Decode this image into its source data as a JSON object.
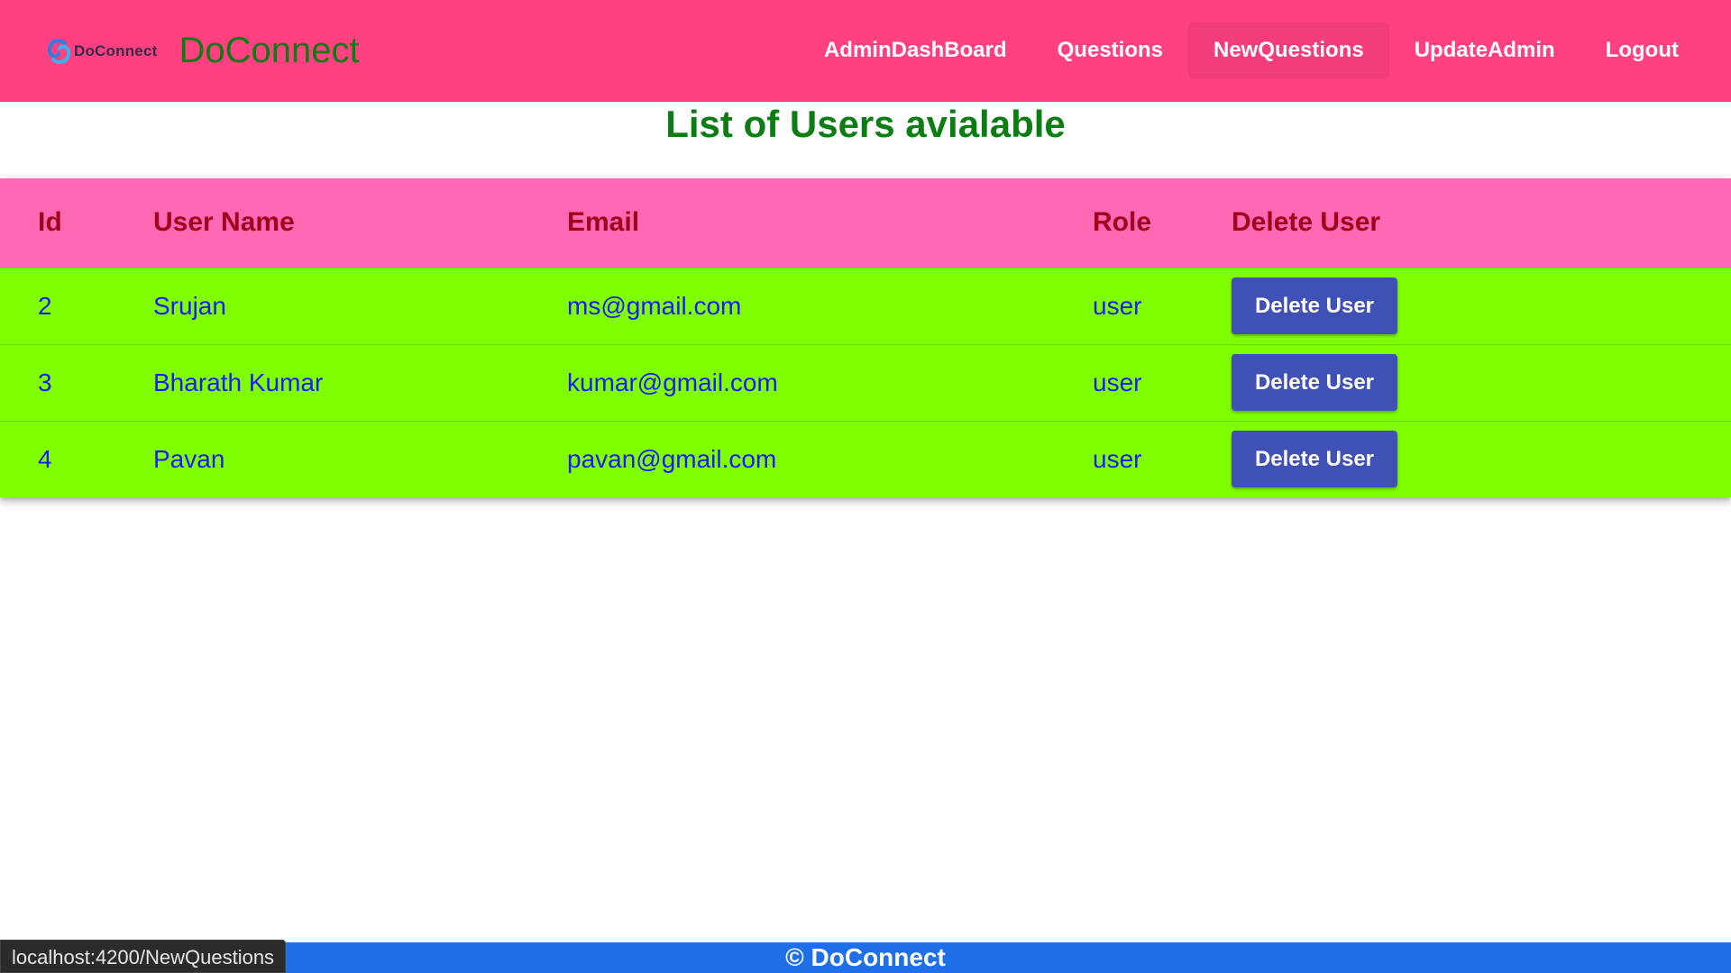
{
  "brand": {
    "logo_text": "DoConnect",
    "title": "DoConnect"
  },
  "nav": {
    "items": [
      {
        "label": "AdminDashBoard"
      },
      {
        "label": "Questions"
      },
      {
        "label": "NewQuestions",
        "active": true
      },
      {
        "label": "UpdateAdmin"
      },
      {
        "label": "Logout"
      }
    ]
  },
  "page": {
    "heading": "List of Users avialable"
  },
  "table": {
    "headers": [
      "Id",
      "User Name",
      "Email",
      "Role",
      "Delete User"
    ],
    "rows": [
      {
        "id": "2",
        "name": "Srujan",
        "email": "ms@gmail.com",
        "role": "user",
        "action": "Delete User"
      },
      {
        "id": "3",
        "name": "Bharath Kumar",
        "email": "kumar@gmail.com",
        "role": "user",
        "action": "Delete User"
      },
      {
        "id": "4",
        "name": "Pavan",
        "email": "pavan@gmail.com",
        "role": "user",
        "action": "Delete User"
      }
    ]
  },
  "footer": {
    "text": "© DoConnect"
  },
  "status_bar": {
    "url": "localhost:4200/NewQuestions"
  },
  "colors": {
    "navbar": "#ff4081",
    "heading": "#0b7d12",
    "table_header": "#ff69b4",
    "row": "#7fff00",
    "button": "#3f51b5",
    "footer": "#1e6fe8"
  }
}
